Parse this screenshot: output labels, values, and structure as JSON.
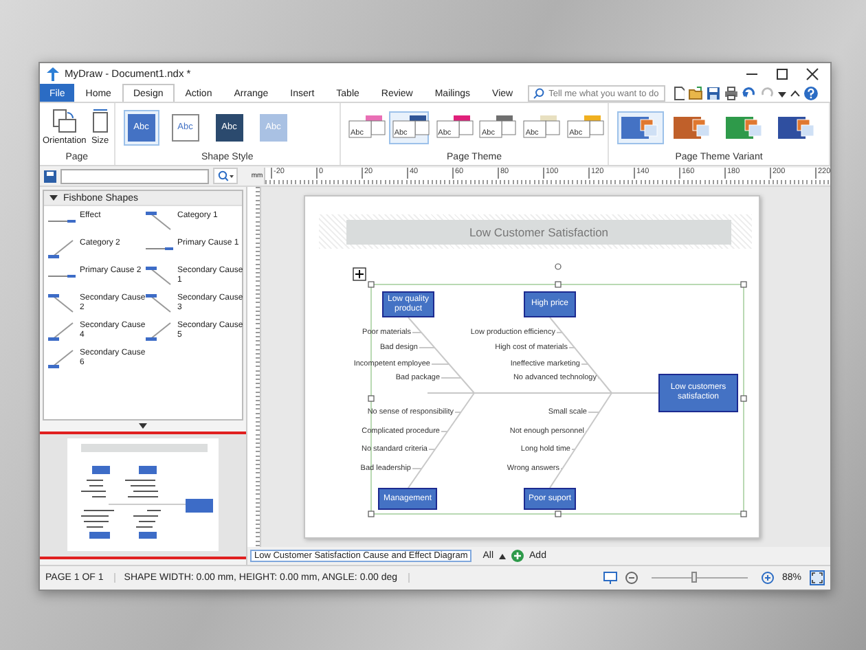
{
  "window": {
    "title": "MyDraw - Document1.ndx *"
  },
  "menu_tabs": [
    {
      "label": "File",
      "kind": "file",
      "selected": false
    },
    {
      "label": "Home",
      "kind": "tab",
      "selected": false
    },
    {
      "label": "Design",
      "kind": "tab",
      "selected": true
    },
    {
      "label": "Action",
      "kind": "tab",
      "selected": false
    },
    {
      "label": "Arrange",
      "kind": "tab",
      "selected": false
    },
    {
      "label": "Insert",
      "kind": "tab",
      "selected": false
    },
    {
      "label": "Table",
      "kind": "tab",
      "selected": false
    },
    {
      "label": "Review",
      "kind": "tab",
      "selected": false
    },
    {
      "label": "Mailings",
      "kind": "tab",
      "selected": false
    },
    {
      "label": "View",
      "kind": "tab",
      "selected": false
    }
  ],
  "search": {
    "placeholder": "Tell me what you want to do"
  },
  "ribbon": {
    "page": {
      "label": "Page",
      "buttons": [
        {
          "label": "Orientation",
          "kind": "orientation"
        },
        {
          "label": "Size",
          "kind": "size"
        }
      ]
    },
    "shape_style": {
      "label": "Shape Style",
      "swatches": [
        {
          "text": "Abc",
          "color": "#4472c4",
          "kind": "filled",
          "selected": true
        },
        {
          "text": "Abc",
          "color": "#4472c4",
          "kind": "outline",
          "selected": false
        },
        {
          "text": "Abc",
          "color": "#2b4a6e",
          "kind": "filled",
          "selected": false
        },
        {
          "text": "Abc",
          "color": "#a9c1e3",
          "kind": "filled",
          "selected": false
        }
      ]
    },
    "page_theme": {
      "label": "Page Theme",
      "themes": [
        {
          "text": "Abc",
          "color": "#e96fb5",
          "selected": false
        },
        {
          "text": "Abc",
          "color": "#2f5597",
          "selected": true
        },
        {
          "text": "Abc",
          "color": "#e0207a",
          "selected": false
        },
        {
          "text": "Abc",
          "color": "#6f6f6f",
          "selected": false
        },
        {
          "text": "Abc",
          "color": "#e8e0c0",
          "selected": false
        },
        {
          "text": "Abc",
          "color": "#f0b020",
          "selected": false
        }
      ]
    },
    "page_theme_variant": {
      "label": "Page Theme Variant",
      "variants": [
        {
          "color": "#4472c4",
          "selected": true
        },
        {
          "color": "#c0602a",
          "selected": false
        },
        {
          "color": "#2e9a4a",
          "selected": false
        },
        {
          "color": "#2f4fa0",
          "selected": false
        }
      ]
    }
  },
  "ruler": {
    "unit": "mm",
    "labels": [
      "-20",
      "0",
      "20",
      "40",
      "60",
      "80",
      "100",
      "120",
      "140",
      "160",
      "180",
      "200",
      "220"
    ]
  },
  "shapes_panel": {
    "title": "Fishbone Shapes",
    "expanded": true,
    "items": [
      {
        "label": "Effect",
        "kind": "hline"
      },
      {
        "label": "Category 1",
        "kind": "down"
      },
      {
        "label": "Category 2",
        "kind": "up"
      },
      {
        "label": "Primary Cause 1",
        "kind": "hline"
      },
      {
        "label": "Primary Cause 2",
        "kind": "hline"
      },
      {
        "label": "Secondary Cause 1",
        "kind": "down"
      },
      {
        "label": "Secondary Cause 2",
        "kind": "down"
      },
      {
        "label": "Secondary Cause 3",
        "kind": "down"
      },
      {
        "label": "Secondary Cause 4",
        "kind": "up"
      },
      {
        "label": "Secondary Cause 5",
        "kind": "up"
      },
      {
        "label": "Secondary Cause 6",
        "kind": "up"
      }
    ]
  },
  "diagram": {
    "title": "Low Customer Satisfaction",
    "effect": "Low customers satisfaction",
    "categories": [
      {
        "label": "Low quality product",
        "causes": [
          "Poor materials",
          "Bad design",
          "Incompetent employee",
          "Bad package"
        ]
      },
      {
        "label": "High price",
        "causes": [
          "Low production efficiency",
          "High cost of materials",
          "Ineffective marketing",
          "No advanced technology"
        ]
      },
      {
        "label": "Management",
        "causes": [
          "No sense of responsibility",
          "Complicated procedure",
          "No standard criteria",
          "Bad leadership"
        ]
      },
      {
        "label": "Poor suport",
        "causes": [
          "Small scale",
          "Not enough personnel",
          "Long hold time",
          "Wrong answers"
        ]
      }
    ]
  },
  "page_tabs": {
    "tabs": [
      {
        "label": "Low Customer Satisfaction Cause and Effect Diagram",
        "selected": true
      }
    ],
    "filter": "All",
    "add": "Add"
  },
  "status_bar": {
    "page": "PAGE 1 OF 1",
    "shape_info": "SHAPE WIDTH: 0.00 mm, HEIGHT: 0.00 mm, ANGLE: 0.00 deg",
    "level": 0.45,
    "zoom": "88%"
  }
}
